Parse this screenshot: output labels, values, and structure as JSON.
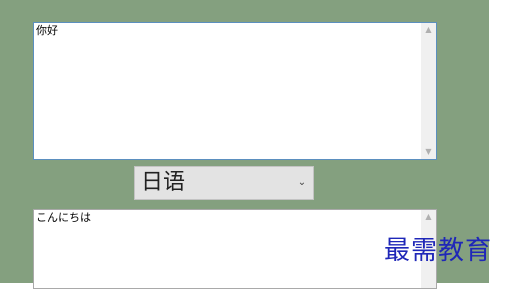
{
  "source": {
    "text": "你好",
    "scroll_up_icon": "arrow-up-icon",
    "scroll_down_icon": "arrow-down-icon"
  },
  "language_select": {
    "selected": "日语",
    "chevron_icon": "chevron-down-icon"
  },
  "result": {
    "text": "こんにちは",
    "scroll_up_icon": "arrow-up-icon"
  },
  "watermark": {
    "text": "最需教育"
  },
  "colors": {
    "background": "#84a07f",
    "watermark": "#1f27b8",
    "select_bg": "#e3e3e3",
    "focus_border": "#5b8fbf"
  }
}
